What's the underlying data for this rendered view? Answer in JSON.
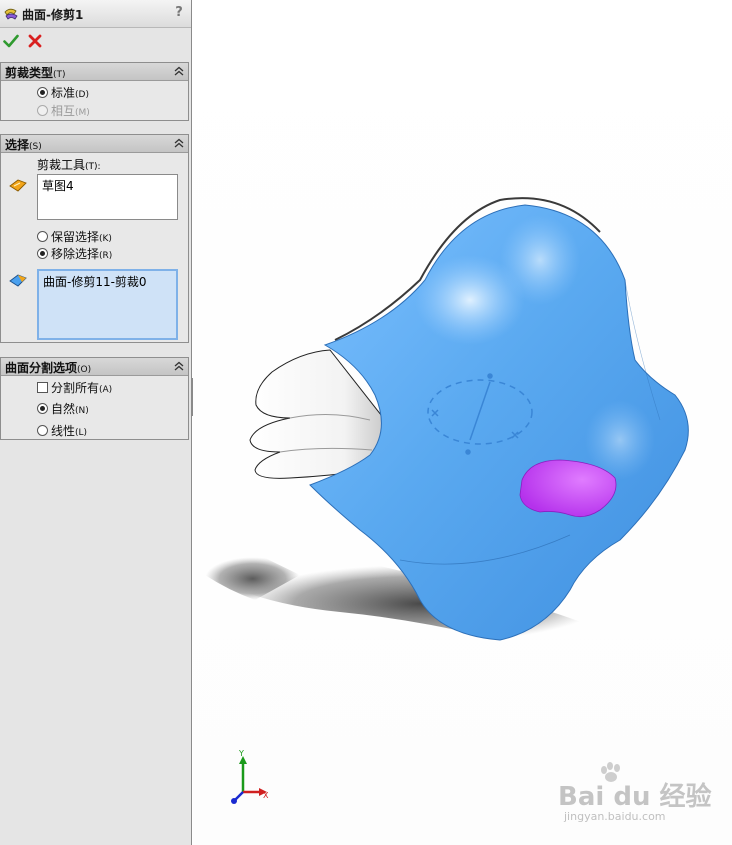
{
  "panel": {
    "title": "曲面-修剪1",
    "help_label": "?",
    "ok_icon": "checkmark-icon",
    "cancel_icon": "x-icon"
  },
  "trim_type": {
    "title": "剪裁类型",
    "title_shortcut": "(T)",
    "options": [
      {
        "label": "标准",
        "shortcut": "(D)",
        "selected": true,
        "enabled": true
      },
      {
        "label": "相互",
        "shortcut": "(M)",
        "selected": false,
        "enabled": false
      }
    ]
  },
  "selection": {
    "title": "选择",
    "title_shortcut": "(S)",
    "trim_tool_label": "剪裁工具",
    "trim_tool_shortcut": "(T):",
    "trim_tool_value": "草图4",
    "keep_option": {
      "label": "保留选择",
      "shortcut": "(K)",
      "selected": false
    },
    "remove_option": {
      "label": "移除选择",
      "shortcut": "(R)",
      "selected": true
    },
    "pieces_value": "曲面-修剪11-剪裁0"
  },
  "split_options": {
    "title": "曲面分割选项",
    "title_shortcut": "(O)",
    "split_all": {
      "label": "分割所有",
      "shortcut": "(A)",
      "checked": false
    },
    "natural": {
      "label": "自然",
      "shortcut": "(N)",
      "selected": true
    },
    "linear": {
      "label": "线性",
      "shortcut": "(L)",
      "selected": false
    }
  },
  "splitter": {
    "glyph": "◂◂◂"
  },
  "triad": {
    "x_label": "X",
    "y_label": "Y"
  },
  "watermark": {
    "brand": "Bai du 经验",
    "url": "jingyan.baidu.com"
  },
  "colors": {
    "surface": "#5aa9f0",
    "selected_piece": "#c040f0",
    "ok_green": "#2f9a2f",
    "cancel_red": "#d92020"
  }
}
